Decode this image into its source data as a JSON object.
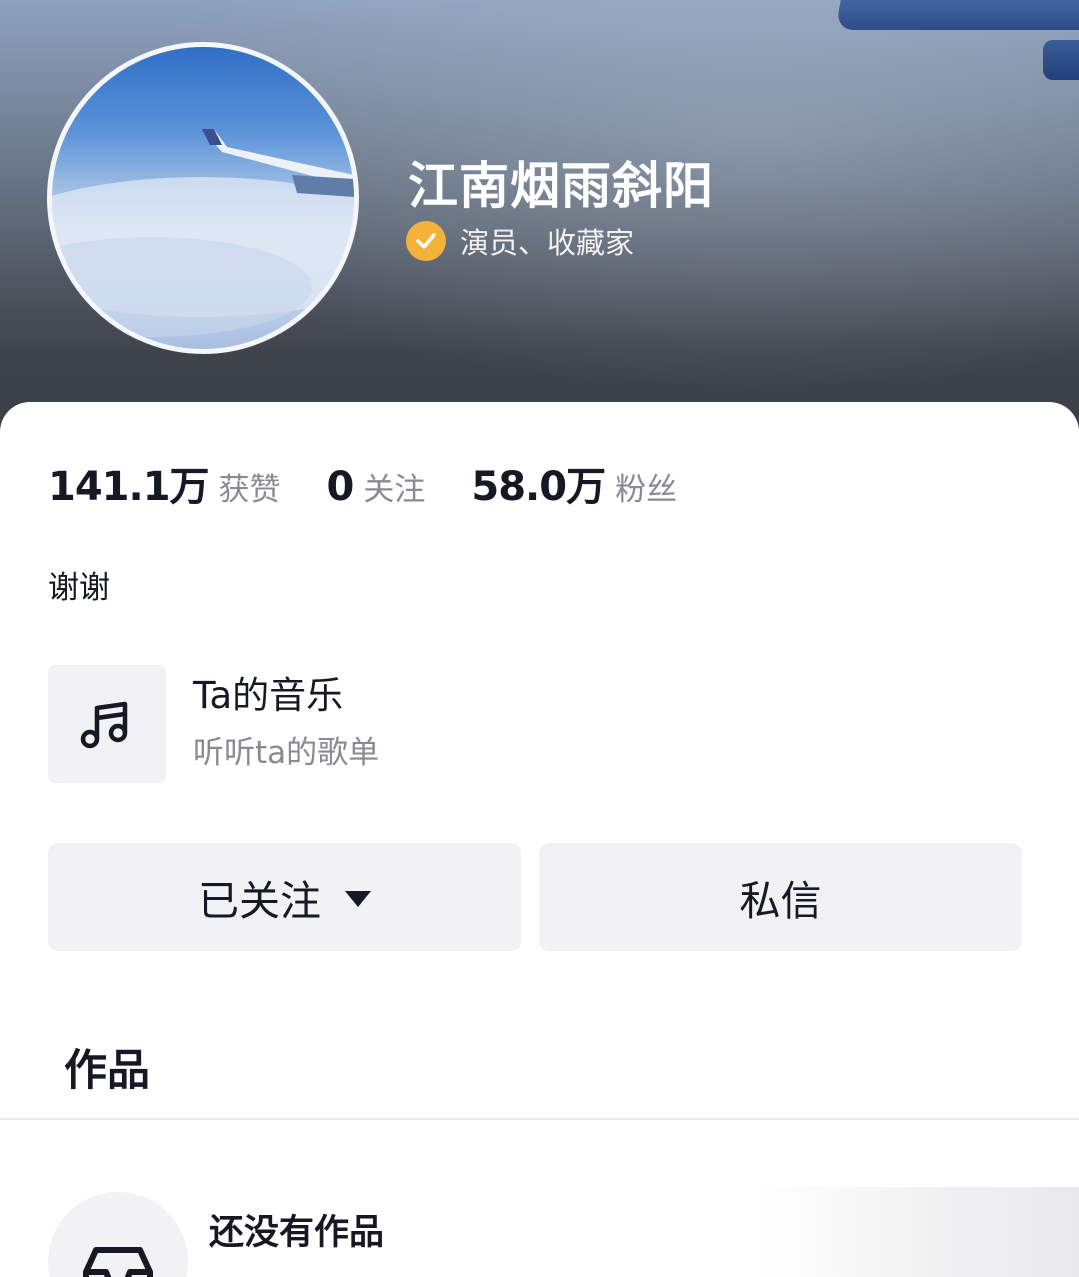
{
  "profile": {
    "username": "江南烟雨斜阳",
    "verify_text": "演员、收藏家",
    "bio": "谢谢"
  },
  "stats": [
    {
      "number": "141.1万",
      "label": "获赞"
    },
    {
      "number": "0",
      "label": "关注"
    },
    {
      "number": "58.0万",
      "label": "粉丝"
    }
  ],
  "music": {
    "title": "Ta的音乐",
    "subtitle": "听听ta的歌单",
    "icon": "music-note-icon"
  },
  "actions": {
    "follow_label": "已关注",
    "message_label": "私信"
  },
  "tabs": {
    "works_label": "作品"
  },
  "empty_state": {
    "title": "还没有作品",
    "icon": "empty-box-icon"
  },
  "colors": {
    "verify_badge": "#f5b23a",
    "text_primary": "#161823",
    "text_secondary": "#8a8b91",
    "button_bg": "#f2f2f4"
  }
}
